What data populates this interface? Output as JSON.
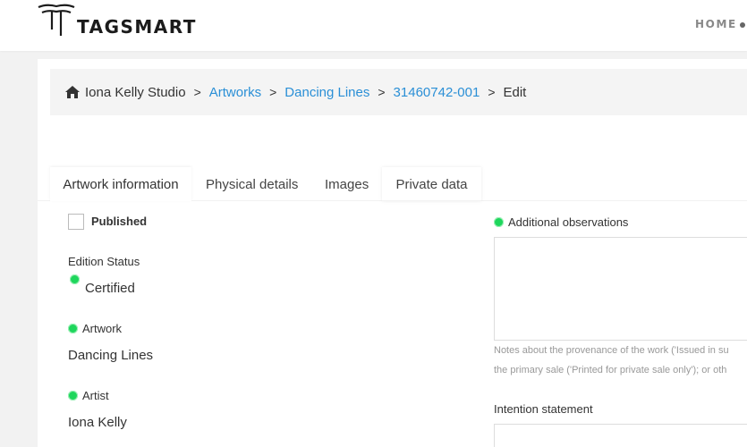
{
  "header": {
    "brand": "TAGSMART",
    "nav_home": "HOME"
  },
  "breadcrumb": {
    "studio": "Iona Kelly Studio",
    "artworks": "Artworks",
    "artwork": "Dancing Lines",
    "id": "31460742-001",
    "current": "Edit",
    "separator": ">"
  },
  "tabs": {
    "artwork_information": "Artwork information",
    "physical_details": "Physical details",
    "images": "Images",
    "private_data": "Private data"
  },
  "form": {
    "published_label": "Published",
    "published_checked": false,
    "edition_status_label": "Edition Status",
    "edition_status_value": "Certified",
    "artwork_label": "Artwork",
    "artwork_value": "Dancing Lines",
    "artist_label": "Artist",
    "artist_value": "Iona Kelly",
    "additional_observations_label": "Additional observations",
    "additional_observations_value": "",
    "help_line_1": "Notes about the provenance of the work ('Issued in su",
    "help_line_2": "the primary sale ('Printed for private sale only'); or oth",
    "intention_statement_label": "Intention statement"
  },
  "colors": {
    "link": "#2a8fd6",
    "required_marker": "#1ed65c"
  },
  "icons": [
    "home-icon",
    "required-icon",
    "logo-mark-icon"
  ]
}
